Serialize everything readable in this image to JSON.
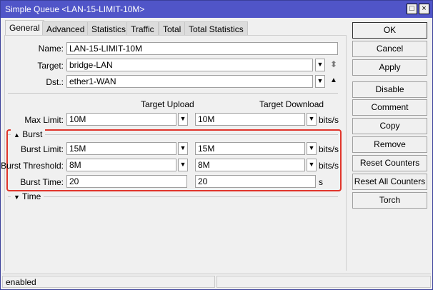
{
  "window": {
    "title": "Simple Queue <LAN-15-LIMIT-10M>",
    "maximize": "□",
    "close": "×"
  },
  "tabs": [
    "General",
    "Advanced",
    "Statistics",
    "Traffic",
    "Total",
    "Total Statistics"
  ],
  "form": {
    "name": {
      "label": "Name:",
      "value": "LAN-15-LIMIT-10M"
    },
    "target": {
      "label": "Target:",
      "value": "bridge-LAN"
    },
    "dst": {
      "label": "Dst.:",
      "value": "ether1-WAN"
    },
    "col_upload": "Target Upload",
    "col_download": "Target Download",
    "max_limit": {
      "label": "Max Limit:",
      "upload": "10M",
      "download": "10M",
      "unit": "bits/s"
    },
    "burst_section": "Burst",
    "burst_limit": {
      "label": "Burst Limit:",
      "upload": "15M",
      "download": "15M",
      "unit": "bits/s"
    },
    "burst_threshold": {
      "label": "Burst Threshold:",
      "upload": "8M",
      "download": "8M",
      "unit": "bits/s"
    },
    "burst_time": {
      "label": "Burst Time:",
      "upload": "20",
      "download": "20",
      "unit": "s"
    },
    "time_section": "Time"
  },
  "buttons": [
    "OK",
    "Cancel",
    "Apply",
    "Disable",
    "Comment",
    "Copy",
    "Remove",
    "Reset Counters",
    "Reset All Counters",
    "Torch"
  ],
  "status": {
    "text": "enabled"
  },
  "icons": {
    "dropdown": "▼",
    "updown": "⬍",
    "up": "▲",
    "collapse": "▲",
    "expand": "▼"
  },
  "colors": {
    "titlebar": "#5055c8",
    "highlight": "#e0352b"
  }
}
